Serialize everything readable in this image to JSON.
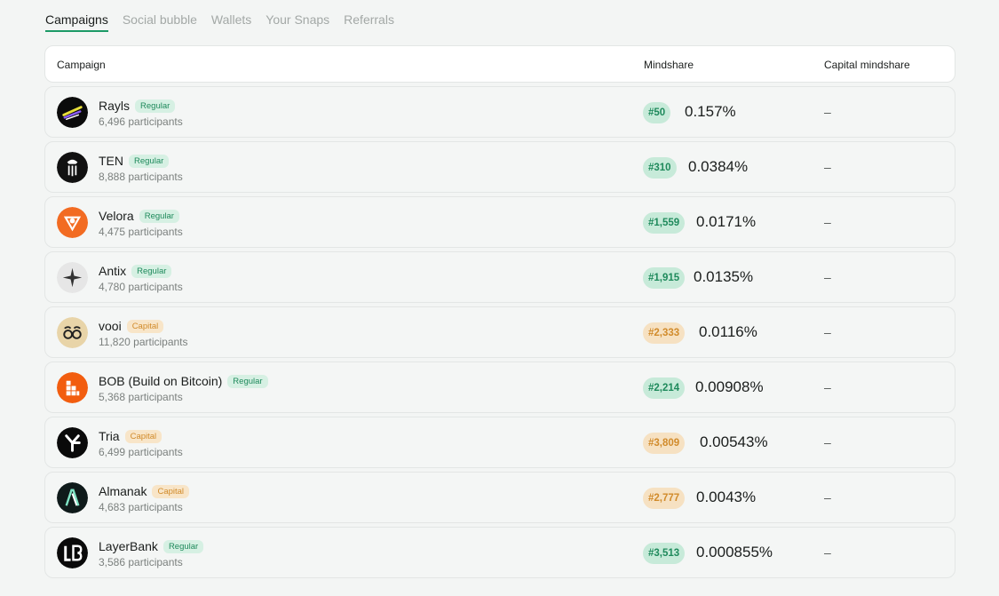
{
  "tabs": [
    "Campaigns",
    "Social bubble",
    "Wallets",
    "Your Snaps",
    "Referrals"
  ],
  "header": {
    "campaign": "Campaign",
    "mindshare": "Mindshare",
    "capital_mindshare": "Capital mindshare"
  },
  "colors": {
    "accent_green": "#1c9a66",
    "regular_badge_bg": "#d6f0e3",
    "capital_badge_bg": "#f8e5c8"
  },
  "rows": [
    {
      "name": "Rayls",
      "type": "Regular",
      "participants": "6,496 participants",
      "rank": "#50",
      "mindshare": "0.157%",
      "capital": "–",
      "logo": "rayls-logo"
    },
    {
      "name": "TEN",
      "type": "Regular",
      "participants": "8,888 participants",
      "rank": "#310",
      "mindshare": "0.0384%",
      "capital": "–",
      "logo": "ten-logo"
    },
    {
      "name": "Velora",
      "type": "Regular",
      "participants": "4,475 participants",
      "rank": "#1,559",
      "mindshare": "0.0171%",
      "capital": "–",
      "logo": "velora-logo"
    },
    {
      "name": "Antix",
      "type": "Regular",
      "participants": "4,780 participants",
      "rank": "#1,915",
      "mindshare": "0.0135%",
      "capital": "–",
      "logo": "antix-logo"
    },
    {
      "name": "vooi",
      "type": "Capital",
      "participants": "11,820 participants",
      "rank": "#2,333",
      "mindshare": "0.0116%",
      "capital": "–",
      "logo": "vooi-logo"
    },
    {
      "name": "BOB (Build on Bitcoin)",
      "type": "Regular",
      "participants": "5,368 participants",
      "rank": "#2,214",
      "mindshare": "0.00908%",
      "capital": "–",
      "logo": "bob-logo"
    },
    {
      "name": "Tria",
      "type": "Capital",
      "participants": "6,499 participants",
      "rank": "#3,809",
      "mindshare": "0.00543%",
      "capital": "–",
      "logo": "tria-logo"
    },
    {
      "name": "Almanak",
      "type": "Capital",
      "participants": "4,683 participants",
      "rank": "#2,777",
      "mindshare": "0.0043%",
      "capital": "–",
      "logo": "almanak-logo"
    },
    {
      "name": "LayerBank",
      "type": "Regular",
      "participants": "3,586 participants",
      "rank": "#3,513",
      "mindshare": "0.000855%",
      "capital": "–",
      "logo": "layerbank-logo"
    }
  ]
}
